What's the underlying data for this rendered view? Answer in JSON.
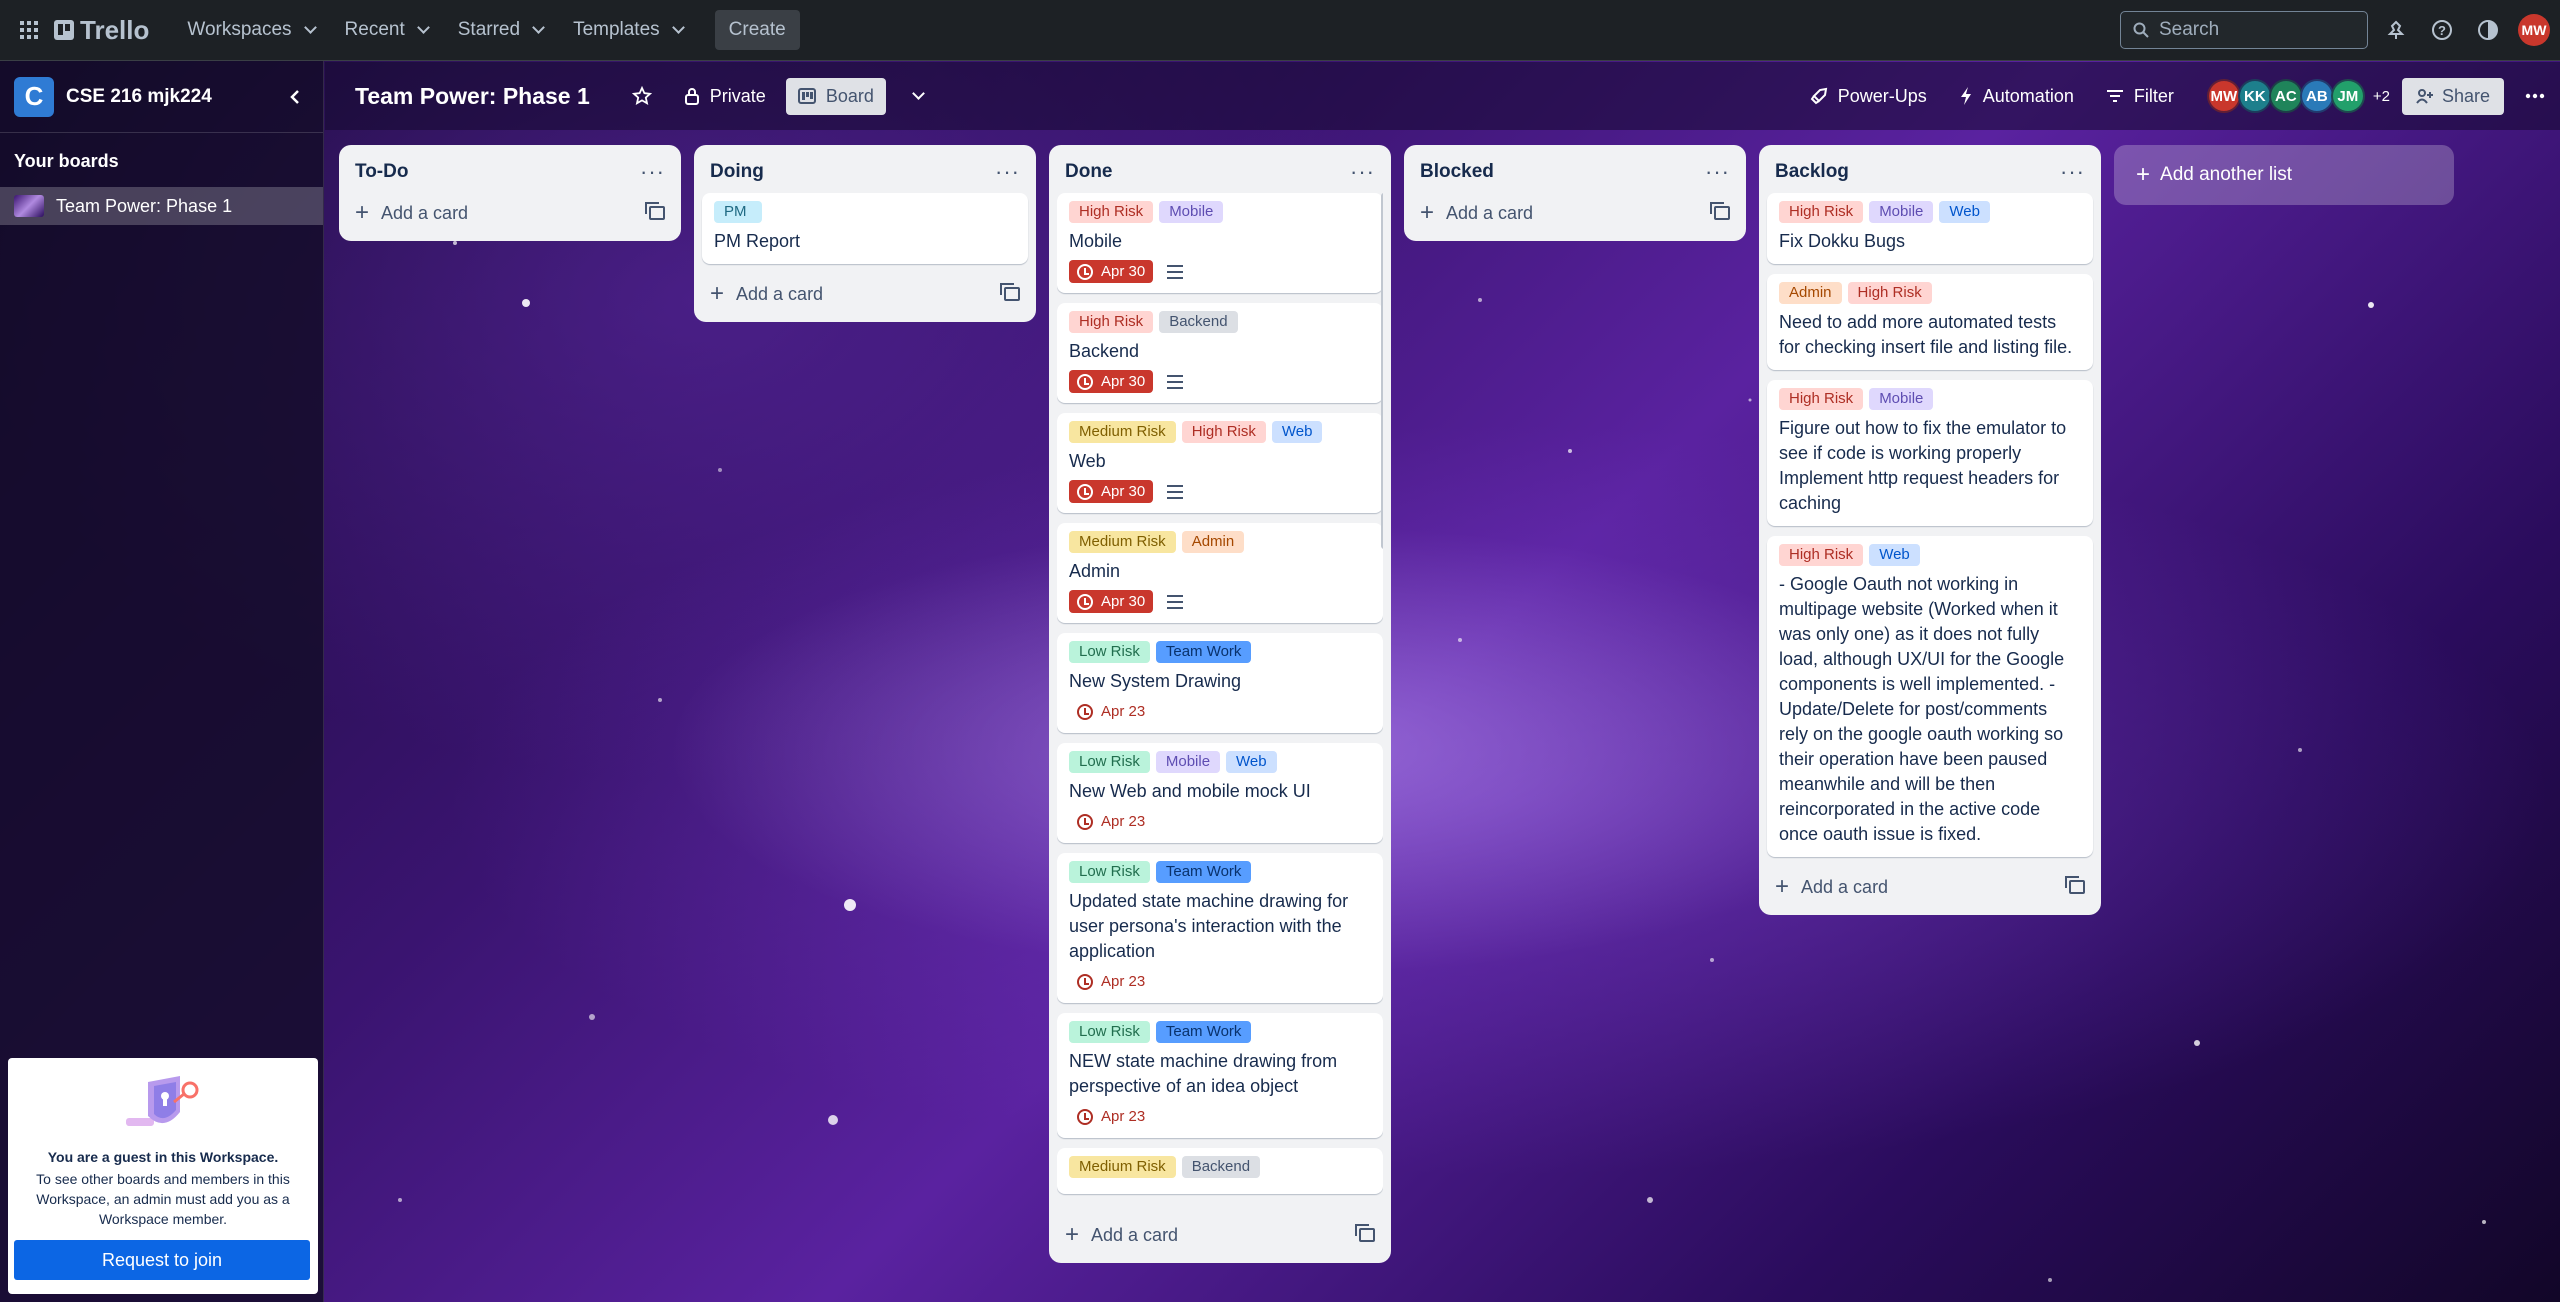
{
  "topbar": {
    "app_name": "Trello",
    "nav": [
      "Workspaces",
      "Recent",
      "Starred",
      "Templates"
    ],
    "create_label": "Create",
    "search_placeholder": "Search",
    "user_initials": "MW"
  },
  "sidebar": {
    "workspace_initial": "C",
    "workspace_name": "CSE 216 mjk224",
    "your_boards_label": "Your boards",
    "boards": [
      "Team Power: Phase 1"
    ],
    "guest_title": "You are a guest in this Workspace.",
    "guest_body": "To see other boards and members in this Workspace, an admin must add you as a Workspace member.",
    "join_label": "Request to join"
  },
  "board": {
    "title": "Team Power: Phase 1",
    "visibility": "Private",
    "view": "Board",
    "powerups_label": "Power-Ups",
    "automation_label": "Automation",
    "filter_label": "Filter",
    "members": [
      {
        "initials": "MW",
        "color": "#c9372c"
      },
      {
        "initials": "KK",
        "color": "#1d7f8c"
      },
      {
        "initials": "AC",
        "color": "#1f845a"
      },
      {
        "initials": "AB",
        "color": "#2a7ab8"
      },
      {
        "initials": "JM",
        "color": "#22a06b"
      }
    ],
    "extra_members": "+2",
    "share_label": "Share",
    "add_card_label": "Add a card",
    "add_list_label": "Add another list"
  },
  "label_colors": {
    "High Risk": {
      "bg": "#ffd5d2",
      "fg": "#ae2e24"
    },
    "Mobile": {
      "bg": "#dfd8fd",
      "fg": "#5e4db2"
    },
    "Web": {
      "bg": "#cce0ff",
      "fg": "#0055cc"
    },
    "Backend": {
      "bg": "#dcdfe4",
      "fg": "#44546f"
    },
    "Medium Risk": {
      "bg": "#f8e6a0",
      "fg": "#7f5f01"
    },
    "Admin": {
      "bg": "#fedec8",
      "fg": "#a54800"
    },
    "Low Risk": {
      "bg": "#baf3db",
      "fg": "#216e4e"
    },
    "Team Work": {
      "bg": "#579dff",
      "fg": "#09326c"
    },
    "PM": {
      "bg": "#c6edfb",
      "fg": "#206a83"
    }
  },
  "lists": {
    "todo": {
      "title": "To-Do",
      "cards": []
    },
    "doing": {
      "title": "Doing",
      "cards": [
        {
          "labels": [
            "PM"
          ],
          "title": "PM Report"
        }
      ]
    },
    "done": {
      "title": "Done",
      "cards": [
        {
          "labels": [
            "High Risk",
            "Mobile"
          ],
          "title": "Mobile",
          "due": "Apr 30",
          "due_state": "overdue",
          "desc": true
        },
        {
          "labels": [
            "High Risk",
            "Backend"
          ],
          "title": "Backend",
          "due": "Apr 30",
          "due_state": "overdue",
          "desc": true
        },
        {
          "labels": [
            "Medium Risk",
            "High Risk",
            "Web"
          ],
          "title": "Web",
          "due": "Apr 30",
          "due_state": "overdue",
          "desc": true
        },
        {
          "labels": [
            "Medium Risk",
            "Admin"
          ],
          "title": "Admin",
          "due": "Apr 30",
          "due_state": "overdue",
          "desc": true
        },
        {
          "labels": [
            "Low Risk",
            "Team Work"
          ],
          "title": "New System Drawing",
          "due": "Apr 23",
          "due_state": "past"
        },
        {
          "labels": [
            "Low Risk",
            "Mobile",
            "Web"
          ],
          "title": "New Web and mobile mock UI",
          "due": "Apr 23",
          "due_state": "past"
        },
        {
          "labels": [
            "Low Risk",
            "Team Work"
          ],
          "title": "Updated state machine drawing for user persona's interaction with the application",
          "due": "Apr 23",
          "due_state": "past"
        },
        {
          "labels": [
            "Low Risk",
            "Team Work"
          ],
          "title": "NEW state machine drawing from perspective of an idea object",
          "due": "Apr 23",
          "due_state": "past"
        },
        {
          "labels": [
            "Medium Risk",
            "Backend"
          ],
          "title": ""
        }
      ]
    },
    "blocked": {
      "title": "Blocked",
      "cards": []
    },
    "backlog": {
      "title": "Backlog",
      "cards": [
        {
          "labels": [
            "High Risk",
            "Mobile",
            "Web"
          ],
          "title": "Fix Dokku Bugs"
        },
        {
          "labels": [
            "Admin",
            "High Risk"
          ],
          "title": "Need to add more automated tests for checking insert file and listing file."
        },
        {
          "labels": [
            "High Risk",
            "Mobile"
          ],
          "title": "Figure out how to fix the emulator to see if code is working properly Implement http request headers for caching"
        },
        {
          "labels": [
            "High Risk",
            "Web"
          ],
          "title": "- Google Oauth not working in multipage website (Worked when it was only one) as it does not fully load, although UX/UI for the Google components is well implemented. - Update/Delete for post/comments rely on the google oauth working so their operation have been paused meanwhile and will be then reincorporated in the active code once oauth issue is fixed."
        }
      ]
    }
  }
}
